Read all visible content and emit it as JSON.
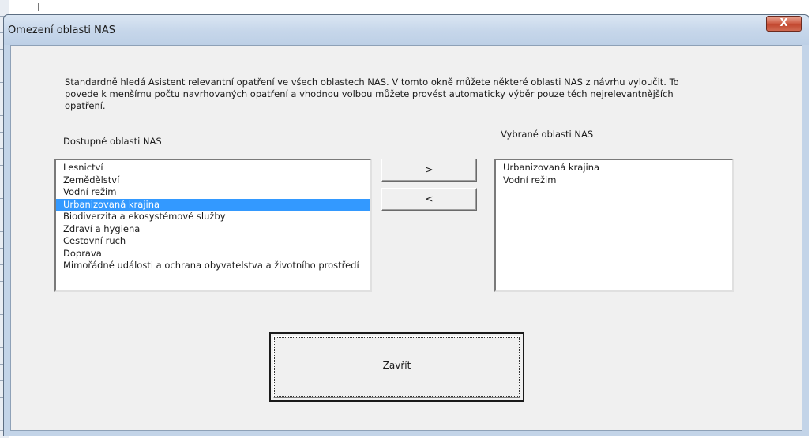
{
  "window": {
    "title": "Omezení oblasti NAS",
    "close_glyph": "X"
  },
  "description": "Standardně hledá Asistent relevantní opatření ve všech oblastech NAS. V tomto okně můžete některé oblasti NAS z návrhu vyloučit. To povede k menšímu počtu navrhovaných opatření a vhodnou volbou můžete provést automaticky výběr pouze těch nejrelevantnějších opatření.",
  "available": {
    "label": "Dostupné oblasti NAS",
    "items": [
      {
        "label": "Lesnictví",
        "selected": false
      },
      {
        "label": "Zemědělství",
        "selected": false
      },
      {
        "label": "Vodní režim",
        "selected": false
      },
      {
        "label": "Urbanizovaná krajina",
        "selected": true
      },
      {
        "label": "Biodiverzita a ekosystémové služby",
        "selected": false
      },
      {
        "label": "Zdraví a hygiena",
        "selected": false
      },
      {
        "label": "Cestovní ruch",
        "selected": false
      },
      {
        "label": "Doprava",
        "selected": false
      },
      {
        "label": "Mimořádné události a ochrana obyvatelstva a životního prostředí",
        "selected": false
      }
    ]
  },
  "selected": {
    "label": "Vybrané oblasti NAS",
    "items": [
      {
        "label": "Urbanizovaná krajina"
      },
      {
        "label": "Vodní režim"
      }
    ]
  },
  "buttons": {
    "add_label": ">",
    "remove_label": "<",
    "close_label": "Zavřít"
  },
  "colors": {
    "selection": "#3399ff",
    "close_button": "#c2472f",
    "titlebar": "#c6d6ea"
  }
}
